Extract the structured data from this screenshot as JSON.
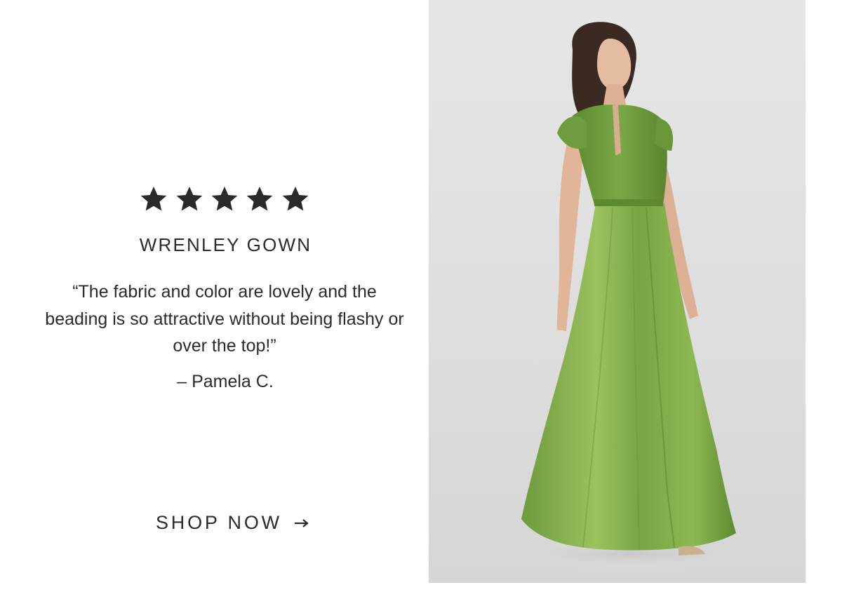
{
  "review": {
    "rating": 5,
    "rating_max": 5,
    "product_name": "WRENLEY GOWN",
    "quote": "“The fabric and color are lovely and the beading is so attractive without being flashy or over the top!”",
    "author": "– Pamela C."
  },
  "cta": {
    "label": "SHOP NOW",
    "icon": "arrow-right-icon"
  },
  "image": {
    "subject": "model-in-green-gown",
    "colors": {
      "dress": "#7ea84a",
      "dress_dark": "#5d8a32",
      "background": "#e2e2e2"
    }
  }
}
